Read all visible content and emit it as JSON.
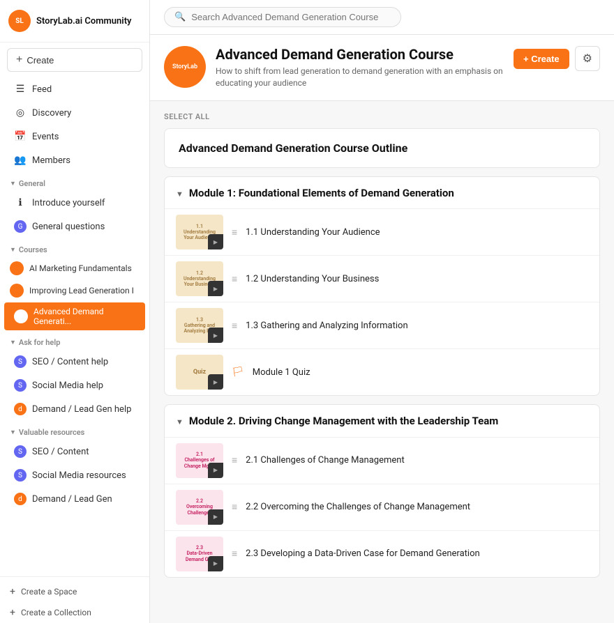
{
  "app": {
    "title": "StoryLab.ai Community",
    "logo_text": "SL"
  },
  "search": {
    "placeholder": "Search Advanced Demand Generation Course"
  },
  "sidebar": {
    "create_label": "Create",
    "nav_items": [
      {
        "id": "feed",
        "label": "Feed",
        "icon": "☰"
      },
      {
        "id": "discovery",
        "label": "Discovery",
        "icon": "◎"
      },
      {
        "id": "events",
        "label": "Events",
        "icon": "📅"
      },
      {
        "id": "members",
        "label": "Members",
        "icon": "👥"
      }
    ],
    "sections": [
      {
        "label": "General",
        "items": [
          {
            "id": "introduce",
            "label": "Introduce yourself",
            "icon": "ℹ"
          },
          {
            "id": "general-q",
            "label": "General questions",
            "icon": "G"
          }
        ]
      },
      {
        "label": "Courses",
        "items": [
          {
            "id": "ai-marketing",
            "label": "AI Marketing Fundamentals",
            "dot": true
          },
          {
            "id": "improving-lead",
            "label": "Improving Lead Generation I",
            "dot": true
          },
          {
            "id": "advanced-demand",
            "label": "Advanced Demand Generati...",
            "dot": true,
            "active": true
          }
        ]
      },
      {
        "label": "Ask for help",
        "items": [
          {
            "id": "seo-content-help",
            "label": "SEO / Content help",
            "icon": "S"
          },
          {
            "id": "social-media-help",
            "label": "Social Media help",
            "icon": "S"
          },
          {
            "id": "demand-lead-help",
            "label": "Demand / Lead Gen help",
            "icon": "d"
          }
        ]
      },
      {
        "label": "Valuable resources",
        "items": [
          {
            "id": "seo-content-res",
            "label": "SEO / Content",
            "icon": "S"
          },
          {
            "id": "social-media-res",
            "label": "Social Media resources",
            "icon": "S"
          },
          {
            "id": "demand-lead-res",
            "label": "Demand / Lead Gen",
            "icon": "d"
          }
        ]
      }
    ],
    "footer_items": [
      {
        "id": "create-space",
        "label": "Create a Space"
      },
      {
        "id": "create-collection",
        "label": "Create a Collection"
      }
    ]
  },
  "course": {
    "name": "Advanced Demand Generation Course",
    "avatar_text": "StoryLab",
    "description": "How to shift from lead generation to demand generation with an emphasis on educating your audience",
    "create_label": "+ Create"
  },
  "content": {
    "select_all": "SELECT ALL",
    "outline_title": "Advanced Demand Generation Course Outline",
    "modules": [
      {
        "id": "module1",
        "title": "Module 1: Foundational Elements of Demand Generation",
        "lessons": [
          {
            "id": "l1_1",
            "title": "1.1 Understanding Your Audience",
            "thumb_label": "1.1\nUnderstanding Your Audience",
            "thumb_color": "warm"
          },
          {
            "id": "l1_2",
            "title": "1.2 Understanding Your Business",
            "thumb_label": "1.2\nUnderstanding Your Business",
            "thumb_color": "warm"
          },
          {
            "id": "l1_3",
            "title": "1.3 Gathering and Analyzing Information",
            "thumb_label": "1.3\nGathering and Analyzing Information",
            "thumb_color": "warm"
          },
          {
            "id": "l1_q",
            "title": "Module 1 Quiz",
            "thumb_label": "Quiz",
            "thumb_color": "warm",
            "icon": "flag"
          }
        ]
      },
      {
        "id": "module2",
        "title": "Module 2. Driving Change Management with the Leadership Team",
        "lessons": [
          {
            "id": "l2_1",
            "title": "2.1 Challenges of Change Management",
            "thumb_label": "2.1\nChallenges of Change Management",
            "thumb_color": "pink"
          },
          {
            "id": "l2_2",
            "title": "2.2 Overcoming the Challenges of Change Management",
            "thumb_label": "2.2\nOvercoming the Challenges of Change Management",
            "thumb_color": "pink"
          },
          {
            "id": "l2_3",
            "title": "2.3 Developing a Data-Driven Case for Demand Generation",
            "thumb_label": "2.3\nDeveloping a Data-Driven Case for Demand Generation",
            "thumb_color": "pink"
          }
        ]
      }
    ]
  }
}
